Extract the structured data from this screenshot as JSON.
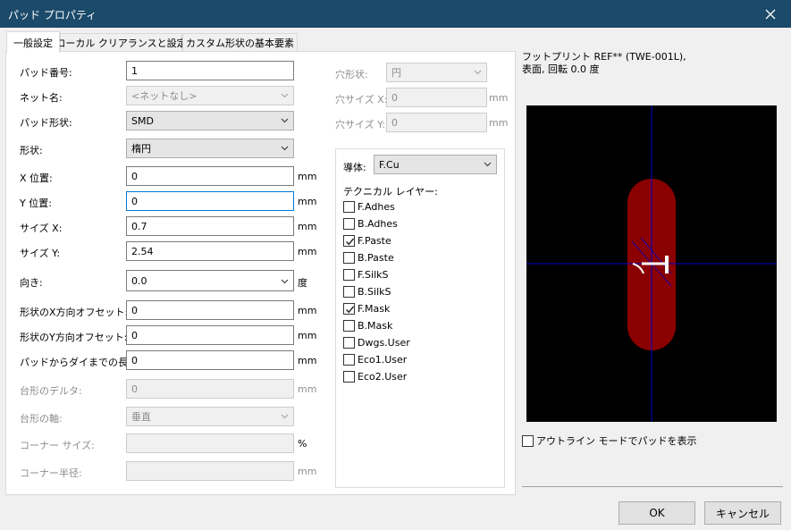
{
  "window": {
    "title": "パッド プロパティ"
  },
  "tabs": [
    "一般設定",
    "ローカル クリアランスと設定",
    "カスタム形状の基本要素"
  ],
  "form": {
    "pad_number": {
      "label": "パッド番号:",
      "value": "1"
    },
    "net_name": {
      "label": "ネット名:",
      "value": "<ネットなし>"
    },
    "pad_type": {
      "label": "パッド形状:",
      "value": "SMD"
    },
    "shape": {
      "label": "形状:",
      "value": "楕円"
    },
    "pos_x": {
      "label": "X 位置:",
      "value": "0",
      "unit": "mm"
    },
    "pos_y": {
      "label": "Y 位置:",
      "value": "0",
      "unit": "mm"
    },
    "size_x": {
      "label": "サイズ X:",
      "value": "0.7",
      "unit": "mm"
    },
    "size_y": {
      "label": "サイズ Y:",
      "value": "2.54",
      "unit": "mm"
    },
    "orientation": {
      "label": "向き:",
      "value": "0.0",
      "unit": "度"
    },
    "offset_x": {
      "label": "形状のX方向オフセット:",
      "value": "0",
      "unit": "mm"
    },
    "offset_y": {
      "label": "形状のY方向オフセット:",
      "value": "0",
      "unit": "mm"
    },
    "die_length": {
      "label": "パッドからダイまでの長さ:",
      "value": "0",
      "unit": "mm"
    },
    "trap_delta": {
      "label": "台形のデルタ:",
      "value": "0",
      "unit": "mm"
    },
    "trap_axis": {
      "label": "台形の軸:",
      "value": "垂直"
    },
    "corner_size": {
      "label": "コーナー サイズ:",
      "value": "",
      "unit": "%"
    },
    "corner_radius": {
      "label": "コーナー半径:",
      "value": "",
      "unit": "mm"
    }
  },
  "drill": {
    "shape": {
      "label": "穴形状:",
      "value": "円"
    },
    "size_x": {
      "label": "穴サイズ X:",
      "value": "0",
      "unit": "mm"
    },
    "size_y": {
      "label": "穴サイズ Y:",
      "value": "0",
      "unit": "mm"
    }
  },
  "layers": {
    "copper": {
      "label": "導体:",
      "value": "F.Cu"
    },
    "technical_label": "テクニカル レイヤー:",
    "items": [
      {
        "name": "F.Adhes",
        "checked": false
      },
      {
        "name": "B.Adhes",
        "checked": false
      },
      {
        "name": "F.Paste",
        "checked": true
      },
      {
        "name": "B.Paste",
        "checked": false
      },
      {
        "name": "F.SilkS",
        "checked": false
      },
      {
        "name": "B.SilkS",
        "checked": false
      },
      {
        "name": "F.Mask",
        "checked": true
      },
      {
        "name": "B.Mask",
        "checked": false
      },
      {
        "name": "Dwgs.User",
        "checked": false
      },
      {
        "name": "Eco1.User",
        "checked": false
      },
      {
        "name": "Eco2.User",
        "checked": false
      }
    ]
  },
  "preview": {
    "info_line1": "フットプリント REF** (TWE-001L),",
    "info_line2": "表面, 回転 0.0 度",
    "outline_label": "アウトライン モードでパッドを表示",
    "outline_checked": false,
    "pad_color": "#8b0000",
    "axis_color": "#0000cc"
  },
  "buttons": {
    "ok": "OK",
    "cancel": "キャンセル"
  }
}
